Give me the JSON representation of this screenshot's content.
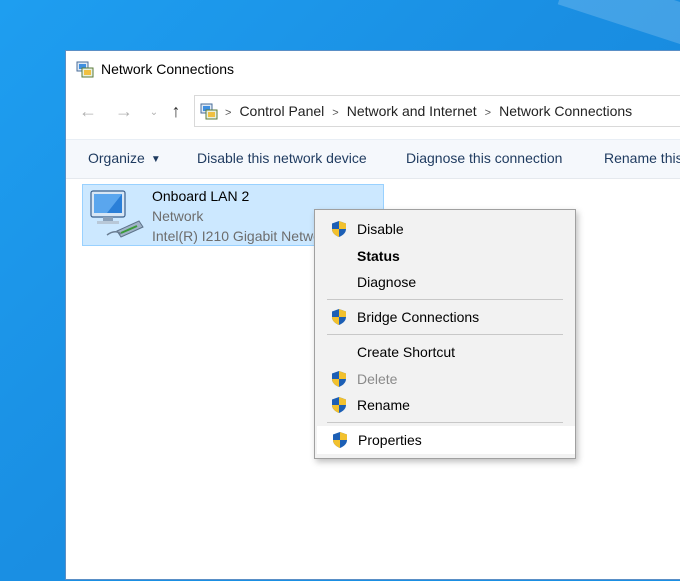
{
  "window": {
    "title": "Network Connections"
  },
  "nav": {
    "back_glyph": "←",
    "forward_glyph": "→",
    "recent_glyph": "⌄",
    "up_glyph": "↑",
    "breadcrumbs": [
      "Control Panel",
      "Network and Internet",
      "Network Connections"
    ],
    "separator": ">"
  },
  "toolbar": {
    "organize": "Organize",
    "disable_device": "Disable this network device",
    "diagnose": "Diagnose this connection",
    "rename": "Rename this"
  },
  "connection": {
    "name": "Onboard LAN 2",
    "type": "Network",
    "adapter": "Intel(R) I210 Gigabit Network Connection"
  },
  "context_menu": {
    "items": [
      {
        "label": "Disable",
        "shield": true,
        "enabled": true,
        "bold": false
      },
      {
        "label": "Status",
        "shield": false,
        "enabled": true,
        "bold": true
      },
      {
        "label": "Diagnose",
        "shield": false,
        "enabled": true,
        "bold": false
      },
      {
        "label": "Bridge Connections",
        "shield": true,
        "enabled": true,
        "bold": false
      },
      {
        "label": "Create Shortcut",
        "shield": false,
        "enabled": true,
        "bold": false
      },
      {
        "label": "Delete",
        "shield": true,
        "enabled": false,
        "bold": false
      },
      {
        "label": "Rename",
        "shield": true,
        "enabled": true,
        "bold": false
      },
      {
        "label": "Properties",
        "shield": true,
        "enabled": true,
        "bold": false,
        "highlighted": true
      }
    ]
  },
  "colors": {
    "desktop": "#1a8fe3",
    "selection": "#cce8ff",
    "shield_blue": "#1c5fb5",
    "shield_gold": "#f2c12e"
  }
}
